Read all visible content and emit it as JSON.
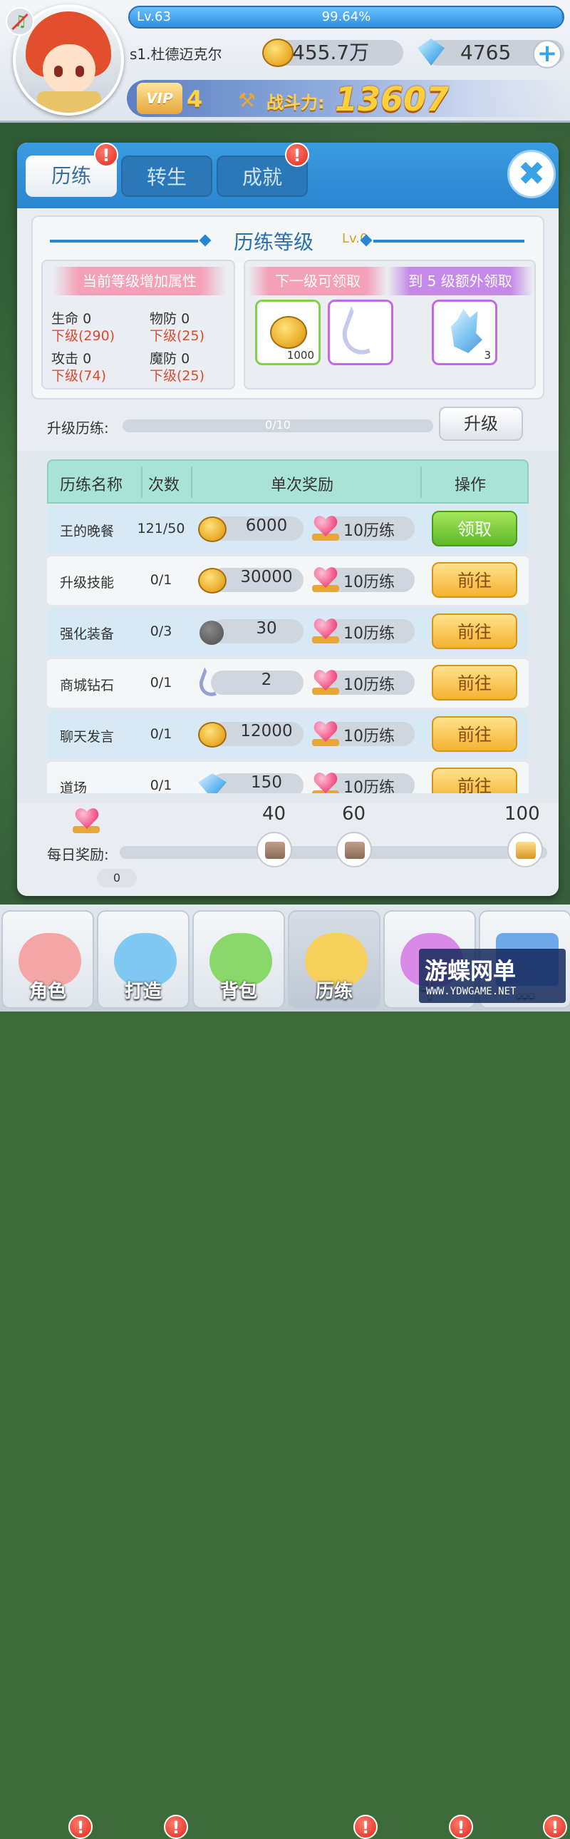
{
  "header": {
    "level": "Lv.63",
    "exp_percent": "99.64%",
    "exp_fraction": 0.9964,
    "player_name": "s1.杜德迈克尔",
    "gold": "455.7万",
    "diamonds": "4765",
    "vip_label": "VIP",
    "vip_level": "4",
    "power_label": "战斗力:",
    "power_value": "13607",
    "icons": {
      "sound": "music-note-icon",
      "gold": "coin-icon",
      "diamond": "diamond-icon",
      "add": "plus-icon"
    }
  },
  "tabs": [
    {
      "label": "历练",
      "active": true,
      "badge": "!"
    },
    {
      "label": "转生",
      "active": false
    },
    {
      "label": "成就",
      "active": false,
      "badge": "!"
    }
  ],
  "close_label": "✖",
  "level_section": {
    "title": "历练等级",
    "level": "Lv.0",
    "attr_header": "当前等级增加属性",
    "attrs": [
      {
        "name": "生命",
        "value": "0",
        "next": "下级(290)"
      },
      {
        "name": "物防",
        "value": "0",
        "next": "下级(25)"
      },
      {
        "name": "攻击",
        "value": "0",
        "next": "下级(74)"
      },
      {
        "name": "魔防",
        "value": "0",
        "next": "下级(25)"
      }
    ],
    "next_reward_header": "下一级可领取",
    "extra_reward_header": "到 5 级额外领取",
    "next_rewards": [
      {
        "icon": "coin-icon",
        "count": "1000"
      },
      {
        "icon": "feather-icon",
        "count": ""
      }
    ],
    "extra_rewards": [
      {
        "icon": "crystal-icon",
        "count": "3"
      }
    ]
  },
  "upgrade": {
    "label": "升级历练:",
    "progress": "0/10",
    "progress_fraction": 0,
    "button": "升级"
  },
  "task_table": {
    "headers": [
      "历练名称",
      "次数",
      "单次奖励",
      "操作"
    ],
    "rows": [
      {
        "name": "王的晚餐",
        "count": "121/50",
        "reward_icon": "coin-icon",
        "reward": "6000",
        "gain": "10历练",
        "action": "领取",
        "action_type": "claim"
      },
      {
        "name": "升级技能",
        "count": "0/1",
        "reward_icon": "coin-icon",
        "reward": "30000",
        "gain": "10历练",
        "action": "前往",
        "action_type": "go"
      },
      {
        "name": "强化装备",
        "count": "0/3",
        "reward_icon": "stone-icon",
        "reward": "30",
        "gain": "10历练",
        "action": "前往",
        "action_type": "go"
      },
      {
        "name": "商城钻石",
        "count": "0/1",
        "reward_icon": "feather-icon",
        "reward": "2",
        "gain": "10历练",
        "action": "前往",
        "action_type": "go"
      },
      {
        "name": "聊天发言",
        "count": "0/1",
        "reward_icon": "coin-icon",
        "reward": "12000",
        "gain": "10历练",
        "action": "前往",
        "action_type": "go"
      },
      {
        "name": "道场",
        "count": "0/1",
        "reward_icon": "diamond-icon",
        "reward": "150",
        "gain": "10历练",
        "action": "前往",
        "action_type": "go"
      }
    ]
  },
  "daily": {
    "label": "每日奖励:",
    "value": "0",
    "milestones": [
      "40",
      "60",
      "100"
    ]
  },
  "bottom_nav": [
    {
      "label": "角色",
      "color": "#f4a6a6",
      "badge": "!"
    },
    {
      "label": "打造",
      "color": "#7fc8f2",
      "badge": "!"
    },
    {
      "label": "背包",
      "color": "#8ad86a",
      "badge": ""
    },
    {
      "label": "历练",
      "color": "#f6d05a",
      "badge": "!",
      "active": true
    },
    {
      "label": "十",
      "color": "#d98ae8",
      "badge": "!"
    },
    {
      "label": "…",
      "color": "#6fa8e8",
      "badge": "!"
    }
  ],
  "watermark": {
    "title": "游蝶网单",
    "url": "WWW.YDWGAME.NET"
  }
}
